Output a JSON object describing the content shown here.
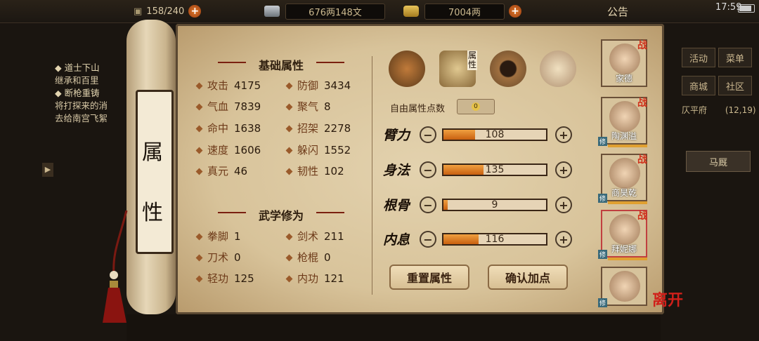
{
  "topbar": {
    "bag_capacity": "158/240",
    "money": "676两148文",
    "gold": "7004两",
    "notice": "公告",
    "time": "17:59"
  },
  "quest": {
    "lines": [
      "◆ 道士下山",
      "继承和百里",
      "◆ 断枪重铸",
      "将打探来的消",
      "去给南宫飞絮"
    ]
  },
  "right_menu": {
    "buttons": [
      "活动",
      "菜单",
      "商城",
      "社区"
    ],
    "location": "仄平府",
    "coords": "(12,19)",
    "stable": "马厩"
  },
  "scroll": {
    "title_chars": [
      "属",
      "性"
    ]
  },
  "basic": {
    "title": "基础属性",
    "left": [
      {
        "k": "攻击",
        "v": "4175"
      },
      {
        "k": "气血",
        "v": "7839"
      },
      {
        "k": "命中",
        "v": "1638"
      },
      {
        "k": "速度",
        "v": "1606"
      },
      {
        "k": "真元",
        "v": "46"
      }
    ],
    "right": [
      {
        "k": "防御",
        "v": "3434"
      },
      {
        "k": "聚气",
        "v": "8"
      },
      {
        "k": "招架",
        "v": "2278"
      },
      {
        "k": "躲闪",
        "v": "1552"
      },
      {
        "k": "韧性",
        "v": "102"
      }
    ]
  },
  "martial": {
    "title": "武学修为",
    "left": [
      {
        "k": "拳脚",
        "v": "1"
      },
      {
        "k": "刀术",
        "v": "0"
      },
      {
        "k": "轻功",
        "v": "125"
      }
    ],
    "right": [
      {
        "k": "剑术",
        "v": "211"
      },
      {
        "k": "枪棍",
        "v": "0"
      },
      {
        "k": "内功",
        "v": "121"
      }
    ]
  },
  "attr_panel": {
    "tab_label": "属性",
    "free_label": "自由属性点数",
    "free_points": "0",
    "rows": [
      {
        "name": "臂力",
        "value": "108",
        "fill_pct": 31
      },
      {
        "name": "身法",
        "value": "135",
        "fill_pct": 39
      },
      {
        "name": "根骨",
        "value": "9",
        "fill_pct": 4
      },
      {
        "name": "内息",
        "value": "116",
        "fill_pct": 34
      }
    ],
    "reset_label": "重置属性",
    "confirm_label": "确认加点"
  },
  "characters": [
    {
      "name": "家德",
      "tag": "战",
      "badge": ""
    },
    {
      "name": "陶渊溢",
      "tag": "战",
      "badge": "修"
    },
    {
      "name": "商昊乾",
      "tag": "战",
      "badge": "修"
    },
    {
      "name": "拜妮娜",
      "tag": "战",
      "badge": "修"
    },
    {
      "name": "",
      "tag": "",
      "badge": "修"
    }
  ],
  "leave_label": "离开",
  "colors": {
    "accent_red": "#d0301a",
    "bar_fill": "#e07a20",
    "parchment": "#dcc8a0"
  }
}
